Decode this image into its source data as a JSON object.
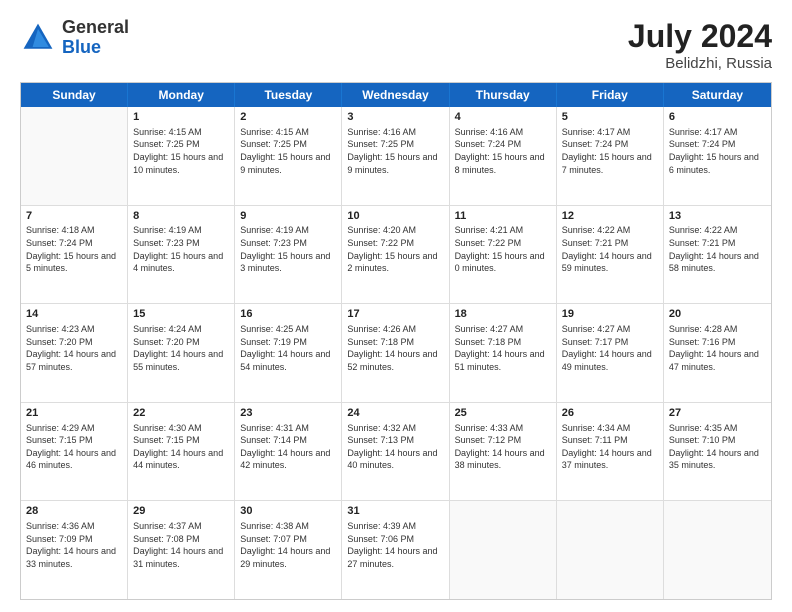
{
  "header": {
    "logo_general": "General",
    "logo_blue": "Blue",
    "month": "July 2024",
    "location": "Belidzhi, Russia"
  },
  "days_of_week": [
    "Sunday",
    "Monday",
    "Tuesday",
    "Wednesday",
    "Thursday",
    "Friday",
    "Saturday"
  ],
  "weeks": [
    [
      {
        "day": "",
        "sunrise": "",
        "sunset": "",
        "daylight": ""
      },
      {
        "day": "1",
        "sunrise": "Sunrise: 4:15 AM",
        "sunset": "Sunset: 7:25 PM",
        "daylight": "Daylight: 15 hours and 10 minutes."
      },
      {
        "day": "2",
        "sunrise": "Sunrise: 4:15 AM",
        "sunset": "Sunset: 7:25 PM",
        "daylight": "Daylight: 15 hours and 9 minutes."
      },
      {
        "day": "3",
        "sunrise": "Sunrise: 4:16 AM",
        "sunset": "Sunset: 7:25 PM",
        "daylight": "Daylight: 15 hours and 9 minutes."
      },
      {
        "day": "4",
        "sunrise": "Sunrise: 4:16 AM",
        "sunset": "Sunset: 7:24 PM",
        "daylight": "Daylight: 15 hours and 8 minutes."
      },
      {
        "day": "5",
        "sunrise": "Sunrise: 4:17 AM",
        "sunset": "Sunset: 7:24 PM",
        "daylight": "Daylight: 15 hours and 7 minutes."
      },
      {
        "day": "6",
        "sunrise": "Sunrise: 4:17 AM",
        "sunset": "Sunset: 7:24 PM",
        "daylight": "Daylight: 15 hours and 6 minutes."
      }
    ],
    [
      {
        "day": "7",
        "sunrise": "Sunrise: 4:18 AM",
        "sunset": "Sunset: 7:24 PM",
        "daylight": "Daylight: 15 hours and 5 minutes."
      },
      {
        "day": "8",
        "sunrise": "Sunrise: 4:19 AM",
        "sunset": "Sunset: 7:23 PM",
        "daylight": "Daylight: 15 hours and 4 minutes."
      },
      {
        "day": "9",
        "sunrise": "Sunrise: 4:19 AM",
        "sunset": "Sunset: 7:23 PM",
        "daylight": "Daylight: 15 hours and 3 minutes."
      },
      {
        "day": "10",
        "sunrise": "Sunrise: 4:20 AM",
        "sunset": "Sunset: 7:22 PM",
        "daylight": "Daylight: 15 hours and 2 minutes."
      },
      {
        "day": "11",
        "sunrise": "Sunrise: 4:21 AM",
        "sunset": "Sunset: 7:22 PM",
        "daylight": "Daylight: 15 hours and 0 minutes."
      },
      {
        "day": "12",
        "sunrise": "Sunrise: 4:22 AM",
        "sunset": "Sunset: 7:21 PM",
        "daylight": "Daylight: 14 hours and 59 minutes."
      },
      {
        "day": "13",
        "sunrise": "Sunrise: 4:22 AM",
        "sunset": "Sunset: 7:21 PM",
        "daylight": "Daylight: 14 hours and 58 minutes."
      }
    ],
    [
      {
        "day": "14",
        "sunrise": "Sunrise: 4:23 AM",
        "sunset": "Sunset: 7:20 PM",
        "daylight": "Daylight: 14 hours and 57 minutes."
      },
      {
        "day": "15",
        "sunrise": "Sunrise: 4:24 AM",
        "sunset": "Sunset: 7:20 PM",
        "daylight": "Daylight: 14 hours and 55 minutes."
      },
      {
        "day": "16",
        "sunrise": "Sunrise: 4:25 AM",
        "sunset": "Sunset: 7:19 PM",
        "daylight": "Daylight: 14 hours and 54 minutes."
      },
      {
        "day": "17",
        "sunrise": "Sunrise: 4:26 AM",
        "sunset": "Sunset: 7:18 PM",
        "daylight": "Daylight: 14 hours and 52 minutes."
      },
      {
        "day": "18",
        "sunrise": "Sunrise: 4:27 AM",
        "sunset": "Sunset: 7:18 PM",
        "daylight": "Daylight: 14 hours and 51 minutes."
      },
      {
        "day": "19",
        "sunrise": "Sunrise: 4:27 AM",
        "sunset": "Sunset: 7:17 PM",
        "daylight": "Daylight: 14 hours and 49 minutes."
      },
      {
        "day": "20",
        "sunrise": "Sunrise: 4:28 AM",
        "sunset": "Sunset: 7:16 PM",
        "daylight": "Daylight: 14 hours and 47 minutes."
      }
    ],
    [
      {
        "day": "21",
        "sunrise": "Sunrise: 4:29 AM",
        "sunset": "Sunset: 7:15 PM",
        "daylight": "Daylight: 14 hours and 46 minutes."
      },
      {
        "day": "22",
        "sunrise": "Sunrise: 4:30 AM",
        "sunset": "Sunset: 7:15 PM",
        "daylight": "Daylight: 14 hours and 44 minutes."
      },
      {
        "day": "23",
        "sunrise": "Sunrise: 4:31 AM",
        "sunset": "Sunset: 7:14 PM",
        "daylight": "Daylight: 14 hours and 42 minutes."
      },
      {
        "day": "24",
        "sunrise": "Sunrise: 4:32 AM",
        "sunset": "Sunset: 7:13 PM",
        "daylight": "Daylight: 14 hours and 40 minutes."
      },
      {
        "day": "25",
        "sunrise": "Sunrise: 4:33 AM",
        "sunset": "Sunset: 7:12 PM",
        "daylight": "Daylight: 14 hours and 38 minutes."
      },
      {
        "day": "26",
        "sunrise": "Sunrise: 4:34 AM",
        "sunset": "Sunset: 7:11 PM",
        "daylight": "Daylight: 14 hours and 37 minutes."
      },
      {
        "day": "27",
        "sunrise": "Sunrise: 4:35 AM",
        "sunset": "Sunset: 7:10 PM",
        "daylight": "Daylight: 14 hours and 35 minutes."
      }
    ],
    [
      {
        "day": "28",
        "sunrise": "Sunrise: 4:36 AM",
        "sunset": "Sunset: 7:09 PM",
        "daylight": "Daylight: 14 hours and 33 minutes."
      },
      {
        "day": "29",
        "sunrise": "Sunrise: 4:37 AM",
        "sunset": "Sunset: 7:08 PM",
        "daylight": "Daylight: 14 hours and 31 minutes."
      },
      {
        "day": "30",
        "sunrise": "Sunrise: 4:38 AM",
        "sunset": "Sunset: 7:07 PM",
        "daylight": "Daylight: 14 hours and 29 minutes."
      },
      {
        "day": "31",
        "sunrise": "Sunrise: 4:39 AM",
        "sunset": "Sunset: 7:06 PM",
        "daylight": "Daylight: 14 hours and 27 minutes."
      },
      {
        "day": "",
        "sunrise": "",
        "sunset": "",
        "daylight": ""
      },
      {
        "day": "",
        "sunrise": "",
        "sunset": "",
        "daylight": ""
      },
      {
        "day": "",
        "sunrise": "",
        "sunset": "",
        "daylight": ""
      }
    ]
  ]
}
